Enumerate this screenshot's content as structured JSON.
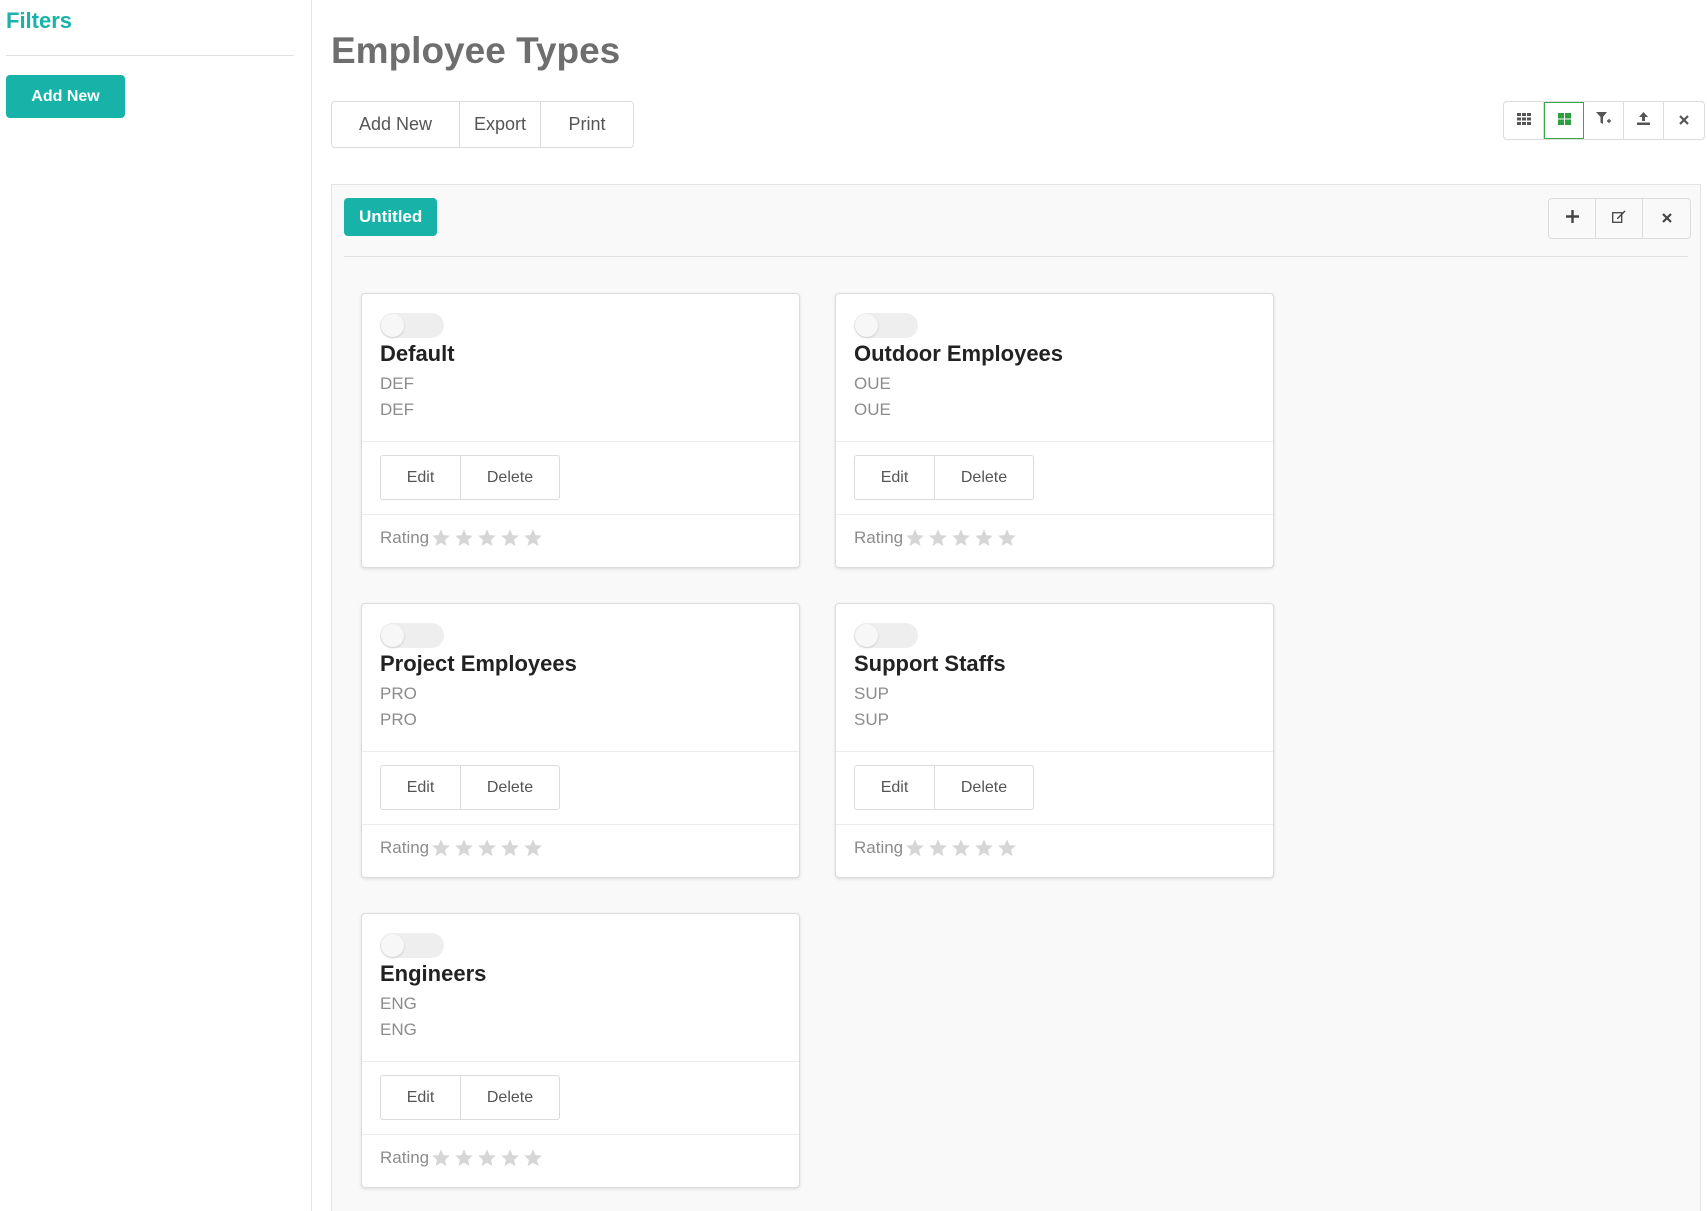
{
  "sidebar": {
    "title": "Filters",
    "add_button": "Add New"
  },
  "page": {
    "title": "Employee Types"
  },
  "actions": {
    "add_new": "Add New",
    "export": "Export",
    "print": "Print"
  },
  "view_toolbar": {
    "items": [
      {
        "icon": "list-grid-icon",
        "active": false
      },
      {
        "icon": "card-grid-icon",
        "active": true
      },
      {
        "icon": "filter-add-icon",
        "active": false
      },
      {
        "icon": "upload-icon",
        "active": false
      },
      {
        "icon": "close-icon",
        "active": false
      }
    ]
  },
  "board": {
    "tag": "Untitled",
    "tools": [
      "plus-icon",
      "edit-icon",
      "close-icon"
    ]
  },
  "cards": [
    {
      "name": "Default",
      "code1": "DEF",
      "code2": "DEF",
      "edit": "Edit",
      "delete": "Delete",
      "rating_label": "Rating",
      "rating": 0,
      "enabled": false
    },
    {
      "name": "Outdoor Employees",
      "code1": "OUE",
      "code2": "OUE",
      "edit": "Edit",
      "delete": "Delete",
      "rating_label": "Rating",
      "rating": 0,
      "enabled": false
    },
    {
      "name": "Project Employees",
      "code1": "PRO",
      "code2": "PRO",
      "edit": "Edit",
      "delete": "Delete",
      "rating_label": "Rating",
      "rating": 0,
      "enabled": false
    },
    {
      "name": "Support Staffs",
      "code1": "SUP",
      "code2": "SUP",
      "edit": "Edit",
      "delete": "Delete",
      "rating_label": "Rating",
      "rating": 0,
      "enabled": false
    },
    {
      "name": "Engineers",
      "code1": "ENG",
      "code2": "ENG",
      "edit": "Edit",
      "delete": "Delete",
      "rating_label": "Rating",
      "rating": 0,
      "enabled": false
    }
  ],
  "colors": {
    "accent": "#17b3a8",
    "active_view": "#2e9e3e",
    "star_empty": "#d6d6d6"
  }
}
